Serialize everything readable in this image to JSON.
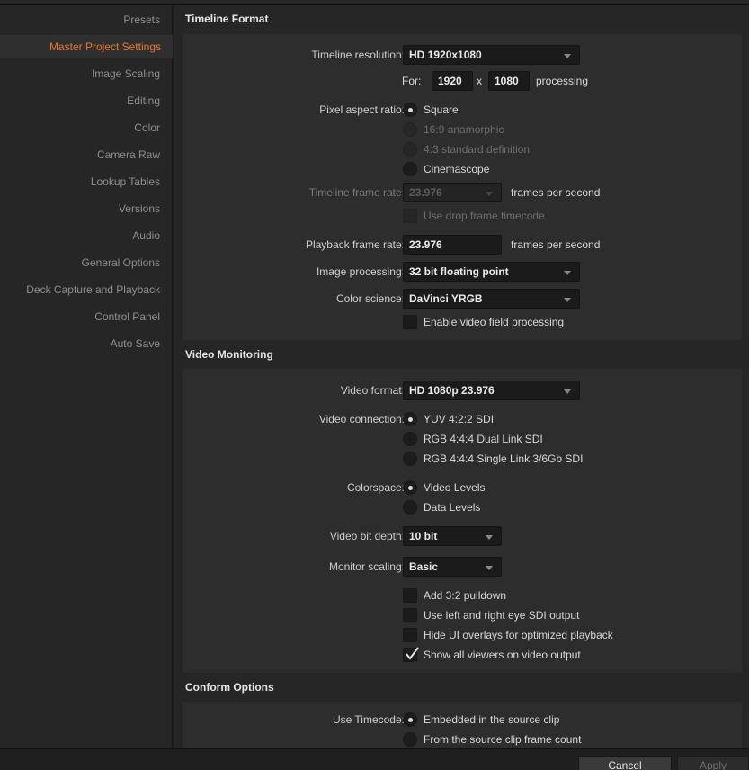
{
  "sidebar": {
    "items": [
      {
        "label": "Presets"
      },
      {
        "label": "Master Project Settings"
      },
      {
        "label": "Image Scaling"
      },
      {
        "label": "Editing"
      },
      {
        "label": "Color"
      },
      {
        "label": "Camera Raw"
      },
      {
        "label": "Lookup Tables"
      },
      {
        "label": "Versions"
      },
      {
        "label": "Audio"
      },
      {
        "label": "General Options"
      },
      {
        "label": "Deck Capture and Playback"
      },
      {
        "label": "Control Panel"
      },
      {
        "label": "Auto Save"
      }
    ],
    "accent_color": "#e8772e"
  },
  "timeline_format": {
    "title": "Timeline Format",
    "resolution_label": "Timeline resolution:",
    "resolution_value": "HD 1920x1080",
    "for_label": "For:",
    "width": "1920",
    "x_label": "x",
    "height": "1080",
    "processing_label": "processing",
    "par_label": "Pixel aspect ratio:",
    "par_options": [
      "Square",
      "16:9 anamorphic",
      "4:3 standard definition",
      "Cinemascope"
    ],
    "frame_rate_label": "Timeline frame rate:",
    "frame_rate_value": "23.976",
    "fps_label": "frames per second",
    "drop_frame_label": "Use drop frame timecode",
    "playback_label": "Playback frame rate:",
    "playback_value": "23.976",
    "playback_fps_label": "frames per second",
    "image_processing_label": "Image processing:",
    "image_processing_value": "32 bit floating point",
    "color_science_label": "Color science:",
    "color_science_value": "DaVinci YRGB",
    "field_processing_label": "Enable video field processing"
  },
  "video_monitoring": {
    "title": "Video Monitoring",
    "format_label": "Video format:",
    "format_value": "HD 1080p 23.976",
    "connection_label": "Video connection:",
    "connection_options": [
      "YUV 4:2:2 SDI",
      "RGB 4:4:4 Dual Link SDI",
      "RGB 4:4:4 Single Link 3/6Gb SDI"
    ],
    "colorspace_label": "Colorspace:",
    "colorspace_options": [
      "Video Levels",
      "Data Levels"
    ],
    "bit_depth_label": "Video bit depth:",
    "bit_depth_value": "10 bit",
    "monitor_scaling_label": "Monitor scaling:",
    "monitor_scaling_value": "Basic",
    "checks": [
      "Add 3:2 pulldown",
      "Use left and right eye SDI output",
      "Hide UI overlays for optimized playback",
      "Show all viewers on video output"
    ]
  },
  "conform_options": {
    "title": "Conform Options",
    "timecode_label": "Use Timecode:",
    "timecode_options": [
      "Embedded in the source clip",
      "From the source clip frame count"
    ]
  },
  "footer": {
    "cancel": "Cancel",
    "apply": "Apply"
  }
}
